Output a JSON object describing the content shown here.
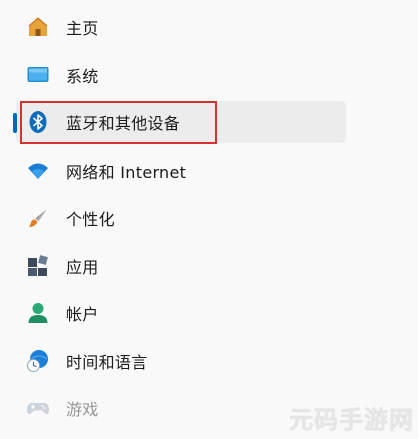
{
  "nav": {
    "items": [
      {
        "label": "主页",
        "icon": "home-icon"
      },
      {
        "label": "系统",
        "icon": "system-monitor-icon"
      },
      {
        "label": "蓝牙和其他设备",
        "icon": "bluetooth-icon",
        "selected": true
      },
      {
        "label": "网络和 Internet",
        "icon": "wifi-icon"
      },
      {
        "label": "个性化",
        "icon": "brush-icon"
      },
      {
        "label": "应用",
        "icon": "apps-icon"
      },
      {
        "label": "帐户",
        "icon": "account-icon"
      },
      {
        "label": "时间和语言",
        "icon": "time-language-icon"
      },
      {
        "label": "游戏",
        "icon": "gamepad-icon"
      }
    ]
  },
  "colors": {
    "accent": "#0067c0",
    "highlight_border": "#d6302f"
  },
  "watermark": {
    "text": "元码手游网"
  }
}
